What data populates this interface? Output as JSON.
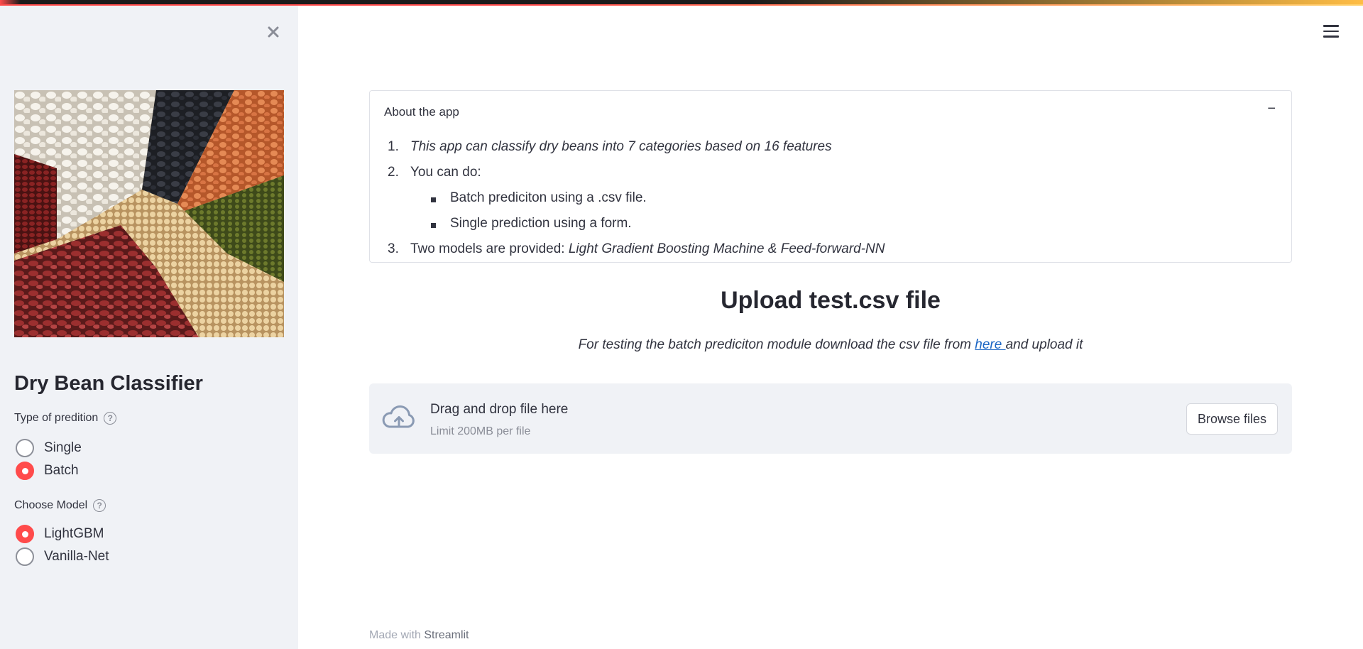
{
  "sidebar": {
    "title": "Dry Bean Classifier",
    "image_alt": "dry beans image",
    "prediction_type": {
      "label": "Type of predition",
      "help": "?",
      "options": [
        "Single",
        "Batch"
      ],
      "selected": "Batch"
    },
    "model": {
      "label": "Choose Model",
      "help": "?",
      "options": [
        "LightGBM",
        "Vanilla-Net"
      ],
      "selected": "LightGBM"
    }
  },
  "expander": {
    "title": "About the app",
    "toggle": "−",
    "items": [
      {
        "num": "1.",
        "text": "This app can classify dry beans into 7 categories based on 16 features"
      },
      {
        "num": "2.",
        "text": "You can do:"
      },
      {
        "sub": "Batch prediciton using a .csv file."
      },
      {
        "sub": "Single prediction using a form."
      },
      {
        "num": "3.",
        "text_plain": "Two models are provided: ",
        "text_italic": "Light Gradient Boosting Machine & Feed-forward-NN"
      }
    ]
  },
  "upload": {
    "title": "Upload test.csv file",
    "desc_before": "For testing the batch prediciton module download the csv file from ",
    "link_text": "here ",
    "desc_after": "and upload it",
    "drop_main": "Drag and drop file here",
    "drop_sub": "Limit 200MB per file",
    "browse_label": "Browse files"
  },
  "footer": {
    "prefix": "Made with ",
    "brand": "Streamlit"
  },
  "colors": {
    "accent": "#ff4b4b",
    "sidebar_bg": "#f0f2f6",
    "link": "#1c66c4"
  }
}
